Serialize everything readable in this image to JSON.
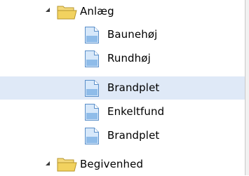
{
  "tree": {
    "nodes": [
      {
        "label": "Anlæg",
        "icon": "folder-icon",
        "expanded": true,
        "selected": false
      },
      {
        "label": "Baunehøj",
        "icon": "document-icon",
        "selected": false
      },
      {
        "label": "Rundhøj",
        "icon": "document-icon",
        "selected": false
      },
      {
        "label": "Brandplet",
        "icon": "document-icon",
        "selected": true
      },
      {
        "label": "Enkeltfund",
        "icon": "document-icon",
        "selected": false
      },
      {
        "label": "Brandplet",
        "icon": "document-icon",
        "selected": false
      },
      {
        "label": "Begivenhed",
        "icon": "folder-icon",
        "expanded": true,
        "selected": false
      }
    ]
  },
  "colors": {
    "selection": "#dfe9f7",
    "folder": "#f2d25f",
    "document": "#8fbce9"
  }
}
